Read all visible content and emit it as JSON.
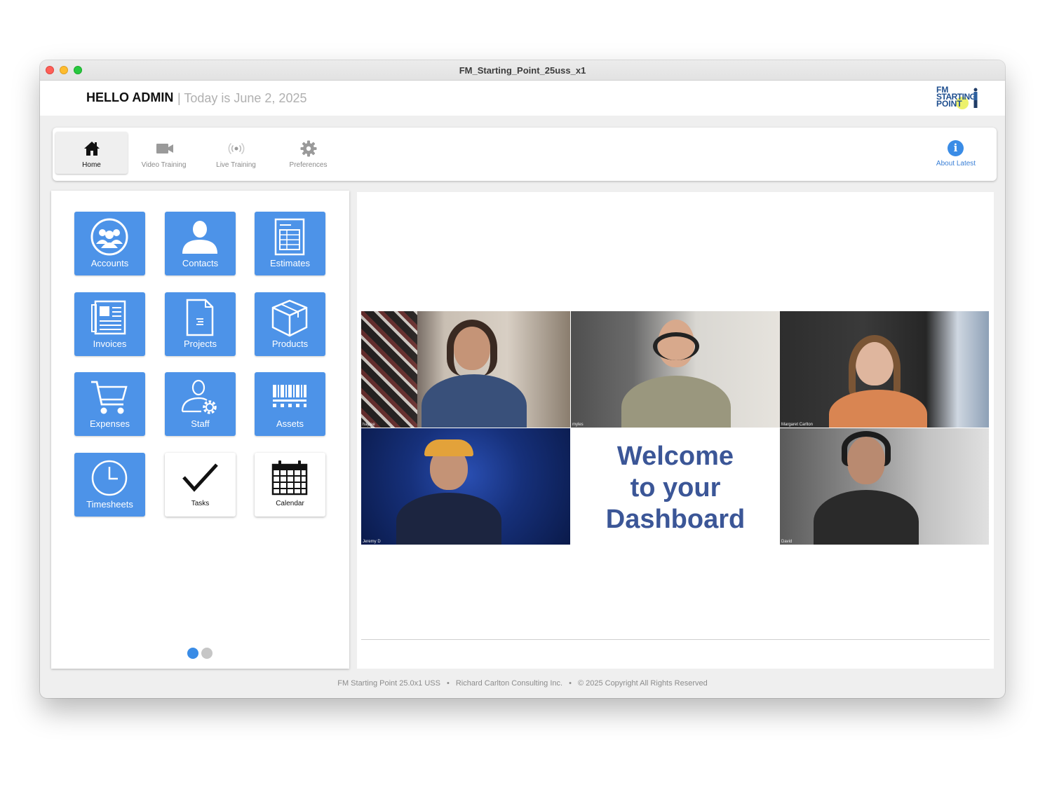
{
  "window": {
    "title": "FM_Starting_Point_25uss_x1"
  },
  "header": {
    "hello": "HELLO ADMIN",
    "date_text": "| Today is June 2, 2025",
    "logo_line1": "FM",
    "logo_line2": "STARTING",
    "logo_line3": "POINT"
  },
  "toolbar": {
    "tabs": [
      {
        "label": "Home",
        "icon": "home-icon"
      },
      {
        "label": "Video Training",
        "icon": "video-camera-icon"
      },
      {
        "label": "Live Training",
        "icon": "broadcast-icon"
      },
      {
        "label": "Preferences",
        "icon": "gear-icon"
      }
    ],
    "about_label": "About Latest",
    "about_icon": "i"
  },
  "tiles": [
    {
      "label": "Accounts",
      "icon": "accounts-icon"
    },
    {
      "label": "Contacts",
      "icon": "contact-icon"
    },
    {
      "label": "Estimates",
      "icon": "estimates-icon"
    },
    {
      "label": "Invoices",
      "icon": "invoice-icon"
    },
    {
      "label": "Projects",
      "icon": "document-icon"
    },
    {
      "label": "Products",
      "icon": "box-icon"
    },
    {
      "label": "Expenses",
      "icon": "cart-icon"
    },
    {
      "label": "Staff",
      "icon": "staff-gear-icon"
    },
    {
      "label": "Assets",
      "icon": "barcode-icon"
    },
    {
      "label": "Timesheets",
      "icon": "clock-icon"
    },
    {
      "label": "Tasks",
      "icon": "checkmark-icon"
    },
    {
      "label": "Calendar",
      "icon": "calendar-icon"
    }
  ],
  "video": {
    "participants": [
      "haylee",
      "myles",
      "Margaret Carlton",
      "Jeremy D",
      "David"
    ],
    "welcome_line1": "Welcome",
    "welcome_line2": "to your",
    "welcome_line3": "Dashboard"
  },
  "footer": {
    "product": "FM Starting Point 25.0x1 USS",
    "company": "Richard Carlton Consulting Inc.",
    "copyright": "© 2025 Copyright All Rights Reserved",
    "separator": "•"
  },
  "colors": {
    "tile_blue": "#4d93e8",
    "accent_blue": "#3a8ce6",
    "welcome_text": "#3b5697"
  }
}
